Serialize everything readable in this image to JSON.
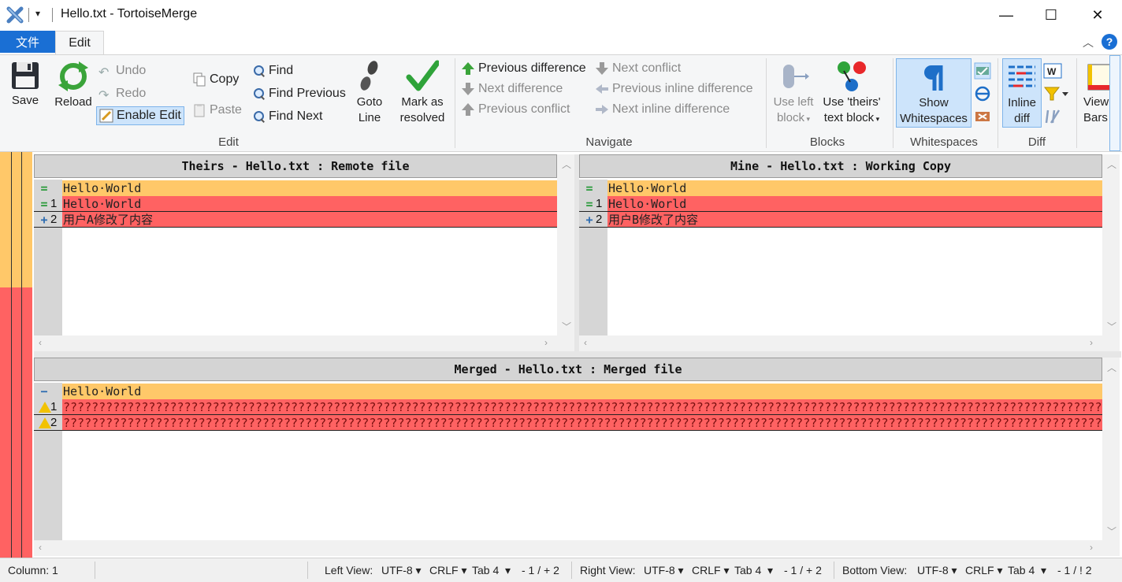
{
  "window": {
    "title": "Hello.txt - TortoiseMerge",
    "qat_dropdown": "▾",
    "minimize": "—",
    "maximize": "☐",
    "close": "✕"
  },
  "tabs": {
    "file": "文件",
    "edit": "Edit",
    "collapse": "︿",
    "help": "?"
  },
  "ribbon": {
    "save": "Save",
    "reload": "Reload",
    "undo": "Undo",
    "redo": "Redo",
    "enable_edit": "Enable Edit",
    "copy": "Copy",
    "paste": "Paste",
    "find": "Find",
    "find_previous": "Find Previous",
    "find_next": "Find Next",
    "goto_line_1": "Goto",
    "goto_line_2": "Line",
    "mark_resolved_1": "Mark as",
    "mark_resolved_2": "resolved",
    "group_edit": "Edit",
    "prev_difference": "Previous difference",
    "next_difference": "Next difference",
    "prev_conflict": "Previous conflict",
    "next_conflict": "Next conflict",
    "prev_inline": "Previous inline difference",
    "next_inline": "Next inline difference",
    "group_navigate": "Navigate",
    "use_left_1": "Use left",
    "use_left_2": "block",
    "use_theirs_1": "Use 'theirs'",
    "use_theirs_2": "text block",
    "group_blocks": "Blocks",
    "show_ws_1": "Show",
    "show_ws_2": "Whitespaces",
    "group_whitespaces": "Whitespaces",
    "inline_diff_1": "Inline",
    "inline_diff_2": "diff",
    "group_diff": "Diff",
    "view_1": "View",
    "view_2": "Bars"
  },
  "panes": {
    "theirs": {
      "header": "Theirs - Hello.txt : Remote file",
      "lines": [
        {
          "mark": "=",
          "num": "",
          "text": "Hello·World"
        },
        {
          "mark": "=",
          "num": "1",
          "text": "Hello·World"
        },
        {
          "mark": "+",
          "num": "2",
          "text": "用户A修改了内容"
        }
      ]
    },
    "mine": {
      "header": "Mine - Hello.txt : Working Copy",
      "lines": [
        {
          "mark": "=",
          "num": "",
          "text": "Hello·World"
        },
        {
          "mark": "=",
          "num": "1",
          "text": "Hello·World"
        },
        {
          "mark": "+",
          "num": "2",
          "text": "用户B修改了内容"
        }
      ]
    },
    "merged": {
      "header": "Merged - Hello.txt : Merged file",
      "lines": [
        {
          "mark": "−",
          "num": "",
          "text": "Hello·World"
        },
        {
          "mark": "!",
          "num": "1",
          "text": "????????????????????????????????????????????????????????????????????????????????????????????????????????????????????????????????????????????????????????"
        },
        {
          "mark": "!",
          "num": "2",
          "text": "????????????????????????????????????????????????????????????????????????????????????????????????????????????????????????????????????????????????????????"
        }
      ]
    }
  },
  "statusbar": {
    "column": "Column: 1",
    "left_view": "Left View:",
    "left_enc": "UTF-8",
    "left_eol": "CRLF",
    "left_tab": "Tab 4",
    "left_diff": "- 1 / + 2",
    "right_view": "Right View:",
    "right_enc": "UTF-8",
    "right_eol": "CRLF",
    "right_tab": "Tab 4",
    "right_diff": "- 1 / + 2",
    "bottom_view": "Bottom View:",
    "bottom_enc": "UTF-8",
    "bottom_eol": "CRLF",
    "bottom_tab": "Tab 4",
    "bottom_diff": "- 1 / ! 2"
  },
  "colors": {
    "conflict": "#ff6262",
    "changed": "#ffc869",
    "accent": "#1a6fd4"
  }
}
